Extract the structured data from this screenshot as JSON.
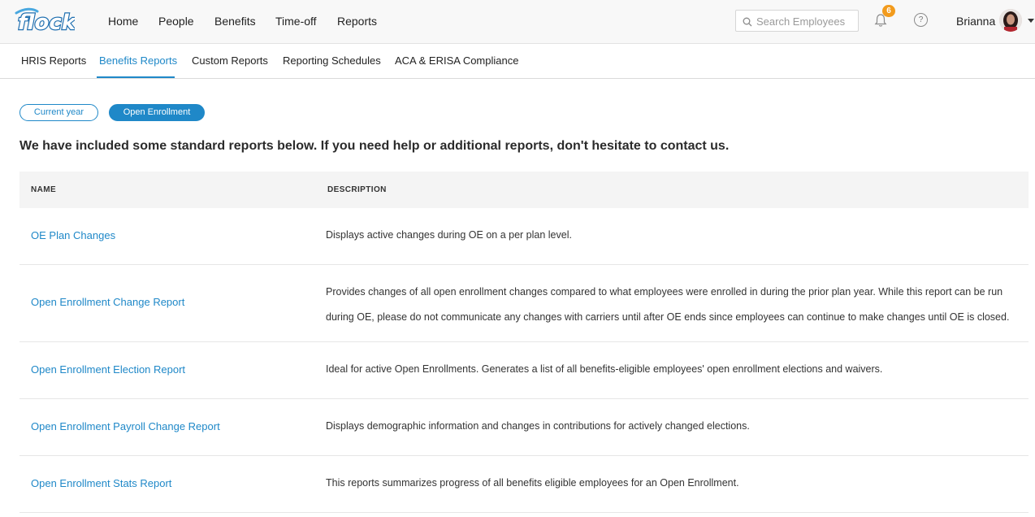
{
  "brand": {
    "logo_text": "flock",
    "accent": "#1f88c8",
    "badge_color": "#f29b1d"
  },
  "nav": {
    "items": [
      {
        "label": "Home"
      },
      {
        "label": "People"
      },
      {
        "label": "Benefits"
      },
      {
        "label": "Time-off"
      },
      {
        "label": "Reports"
      }
    ]
  },
  "search": {
    "placeholder": "Search Employees",
    "value": ""
  },
  "notifications": {
    "count": "6",
    "icon": "bell-icon"
  },
  "help": {
    "glyph": "?"
  },
  "user": {
    "name": "Brianna"
  },
  "subnav": {
    "items": [
      {
        "label": "HRIS Reports"
      },
      {
        "label": "Benefits Reports"
      },
      {
        "label": "Custom Reports"
      },
      {
        "label": "Reporting Schedules"
      },
      {
        "label": "ACA & ERISA Compliance"
      }
    ],
    "active": "Benefits Reports"
  },
  "filters": {
    "current_year": "Current year",
    "open_enrollment": "Open Enrollment",
    "selected": "Open Enrollment"
  },
  "intro": "We have included some standard reports below. If you need help or additional reports, don't hesitate to contact us.",
  "table": {
    "headers": {
      "name": "NAME",
      "description": "DESCRIPTION"
    },
    "rows": [
      {
        "name": "OE Plan Changes",
        "description": "Displays active changes during OE on a per plan level."
      },
      {
        "name": "Open Enrollment Change Report",
        "description": "Provides changes of all open enrollment changes compared to what employees were enrolled in during the prior plan year. While this report can be run during OE, please do not communicate any changes with carriers until after OE ends since employees can continue to make changes until OE is closed."
      },
      {
        "name": "Open Enrollment Election Report",
        "description": "Ideal for active Open Enrollments. Generates a list of all benefits-eligible employees' open enrollment elections and waivers."
      },
      {
        "name": "Open Enrollment Payroll Change Report",
        "description": "Displays demographic information and changes in contributions for actively changed elections."
      },
      {
        "name": "Open Enrollment Stats Report",
        "description": "This reports summarizes progress of all benefits eligible employees for an Open Enrollment."
      }
    ]
  }
}
